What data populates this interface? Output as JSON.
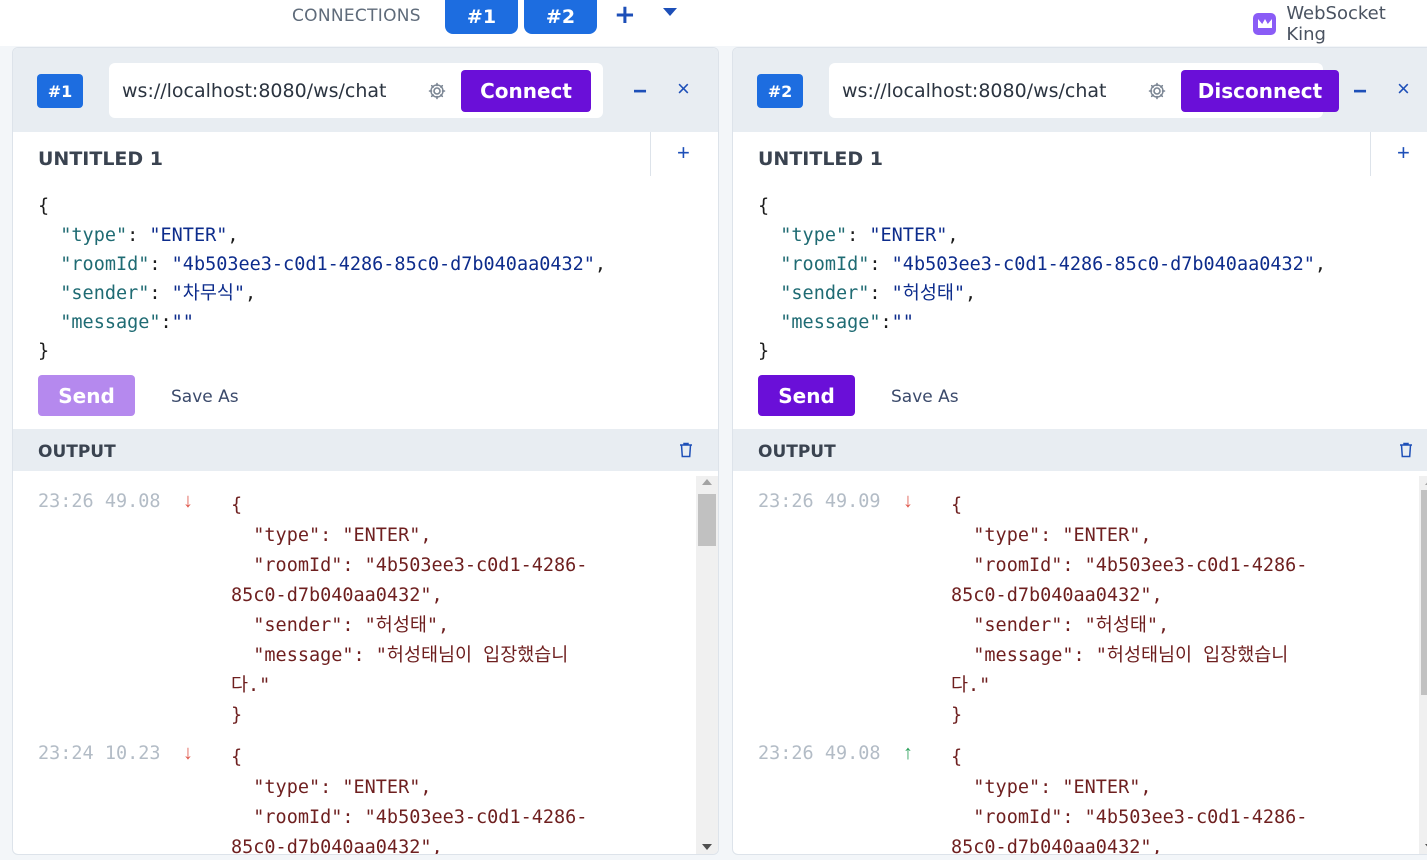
{
  "topbar": {
    "connections_label": "CONNECTIONS",
    "tabs": [
      "#1",
      "#2"
    ],
    "add_label": "+",
    "brand": "WebSocket King",
    "brand_color": "#8a5cf6"
  },
  "panels": [
    {
      "badge": "#1",
      "url": "ws://localhost:8080/ws/chat",
      "connect_label": "Connect",
      "minimize_label": "−",
      "close_label": "×",
      "message_title": "UNTITLED 1",
      "add_label": "+",
      "editor": {
        "open": "{",
        "type_key": "\"type\"",
        "type_val": "\"ENTER\"",
        "room_key": "\"roomId\"",
        "room_val": "\"4b503ee3-c0d1-4286-85c0-d7b040aa0432\"",
        "sender_key": "\"sender\"",
        "sender_val": "\"차무식\"",
        "message_key": "\"message\"",
        "message_val": "\"\"",
        "close": "}"
      },
      "send_label": "Send",
      "send_enabled": false,
      "save_as_label": "Save As",
      "output_title": "OUTPUT",
      "logs": [
        {
          "time": "23:26 49.08",
          "direction": "incoming",
          "arrow": "↓",
          "body": "{\n  \"type\": \"ENTER\",\n  \"roomId\": \"4b503ee3-c0d1-4286-\n85c0-d7b040aa0432\",\n  \"sender\": \"허성태\",\n  \"message\": \"허성태님이 입장했습니\n다.\"\n}"
        },
        {
          "time": "23:24 10.23",
          "direction": "incoming",
          "arrow": "↓",
          "body": "{\n  \"type\": \"ENTER\",\n  \"roomId\": \"4b503ee3-c0d1-4286-\n85c0-d7b040aa0432\","
        }
      ]
    },
    {
      "badge": "#2",
      "url": "ws://localhost:8080/ws/chat",
      "connect_label": "Disconnect",
      "minimize_label": "−",
      "close_label": "×",
      "message_title": "UNTITLED 1",
      "add_label": "+",
      "editor": {
        "open": "{",
        "type_key": "\"type\"",
        "type_val": "\"ENTER\"",
        "room_key": "\"roomId\"",
        "room_val": "\"4b503ee3-c0d1-4286-85c0-d7b040aa0432\"",
        "sender_key": "\"sender\"",
        "sender_val": "\"허성태\"",
        "message_key": "\"message\"",
        "message_val": "\"\"",
        "close": "}"
      },
      "send_label": "Send",
      "send_enabled": true,
      "save_as_label": "Save As",
      "output_title": "OUTPUT",
      "logs": [
        {
          "time": "23:26 49.09",
          "direction": "incoming",
          "arrow": "↓",
          "body": "{\n  \"type\": \"ENTER\",\n  \"roomId\": \"4b503ee3-c0d1-4286-\n85c0-d7b040aa0432\",\n  \"sender\": \"허성태\",\n  \"message\": \"허성태님이 입장했습니\n다.\"\n}"
        },
        {
          "time": "23:26 49.08",
          "direction": "outgoing",
          "arrow": "↑",
          "body": "{\n  \"type\": \"ENTER\",\n  \"roomId\": \"4b503ee3-c0d1-4286-\n85c0-d7b040aa0432\","
        }
      ]
    }
  ]
}
